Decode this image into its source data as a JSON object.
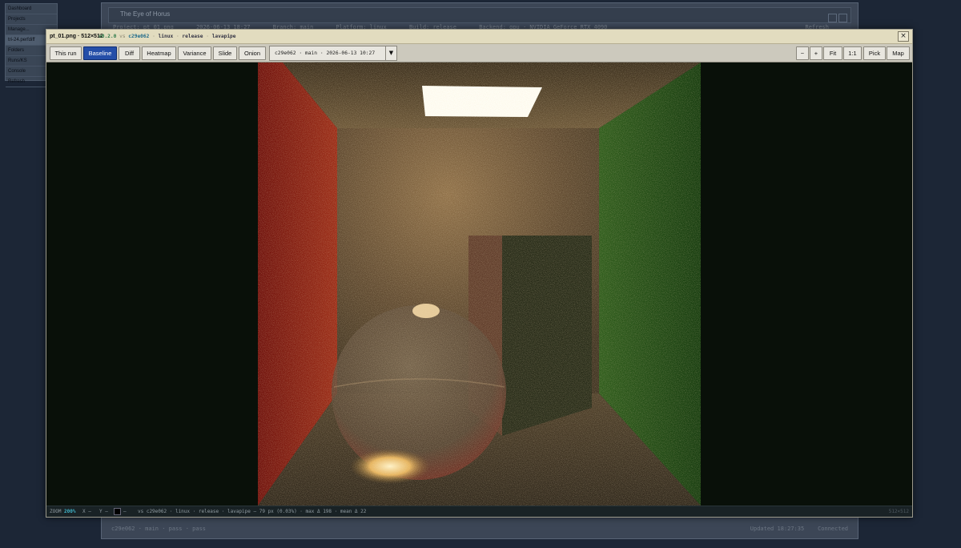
{
  "side_menu": {
    "items": [
      "Dashboard",
      "Projects",
      "Manage...",
      "tri-24.perfdiff",
      "Folders",
      "Runs/KS",
      "Console",
      "Refresh"
    ]
  },
  "background_window": {
    "title": "The Eye of Horus",
    "toolbar_items": [
      "Project: pt_01.png",
      "2026-06-13 18:27",
      "Branch: main",
      "Platform: linux",
      "Build: release",
      "Backend: gpu · NVIDIA GeForce RTX 4090"
    ],
    "refresh_label": "Refresh",
    "status_left": "c29e062 · main · pass · pass",
    "status_right_a": "Updated 18:27:35",
    "status_right_b": "Connected"
  },
  "viewer": {
    "filename": "pt_01.png · 512×512",
    "meta_version": "v0.2.0",
    "meta_vs": "vs",
    "meta_hash": "c29e062",
    "meta_sep": "·",
    "meta_os": "linux",
    "meta_build": "release",
    "meta_backend": "lavapipe",
    "close_label": "×",
    "mode_buttons": [
      "This run",
      "Baseline",
      "Diff",
      "Heatmap",
      "Variance",
      "Slide",
      "Onion"
    ],
    "active_mode": "Baseline",
    "commit_select": "c29e062 · main · 2026-06-13 10:27",
    "zoom_buttons": [
      "−",
      "+",
      "Fit",
      "1:1",
      "Pick",
      "Map"
    ],
    "status": {
      "zoom_label": "ZOOM",
      "zoom_value": "200%",
      "x_label": "X —",
      "y_label": "Y —",
      "pixel_value": "—",
      "summary": "vs c29e062 · linux · release · lavapipe — 79 px (0.03%) · max Δ 198 · mean Δ 22",
      "dims": "512×512"
    }
  },
  "colors": {
    "accent": "#244ea8",
    "titlebar": "#e2dcbf",
    "red_wall": "#8a1a12",
    "green_wall": "#1d4d12",
    "warm_wall": "#7a6443"
  }
}
